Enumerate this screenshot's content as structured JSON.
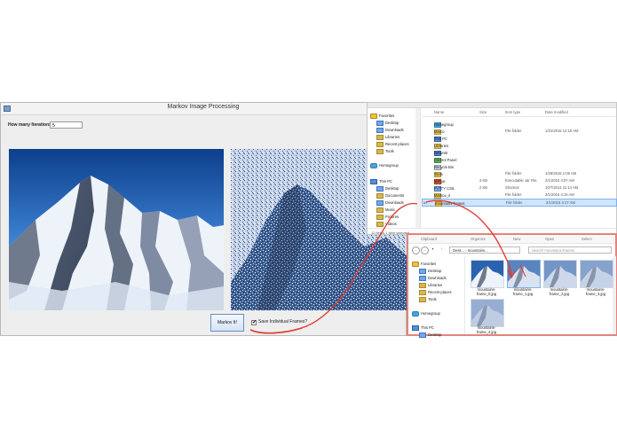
{
  "main_window": {
    "title": "Markov Image Processing",
    "iterations_label": "How many Iterations:",
    "iterations_value": "5",
    "markov_button": "Markov It!",
    "save_frames_label": "Save Individual Frames?",
    "save_frames_checked": "✔"
  },
  "explorer1": {
    "nav": {
      "favorites": "Favorites",
      "desktop": "Desktop",
      "downloads": "Downloads",
      "libraries": "Libraries",
      "recent": "Recent places",
      "tools": "Tools",
      "homegroup": "Homegroup",
      "this_pc": "This PC",
      "pc_items": [
        "Desktop",
        "Documents",
        "Downloads",
        "Music",
        "Pictures",
        "Videos"
      ]
    },
    "columns": [
      "Name",
      "Size",
      "Item type",
      "Date modified"
    ],
    "files": [
      {
        "name": "Homegroup",
        "size": "",
        "type": "",
        "date": ""
      },
      {
        "name": "Marco",
        "size": "",
        "type": "File folder",
        "date": "1/31/2015 12:19 AM"
      },
      {
        "name": "This PC",
        "size": "",
        "type": "",
        "date": ""
      },
      {
        "name": "Libraries",
        "size": "",
        "type": "",
        "date": ""
      },
      {
        "name": "Network",
        "size": "",
        "type": "",
        "date": ""
      },
      {
        "name": "Control Panel",
        "size": "",
        "type": "",
        "date": ""
      },
      {
        "name": "Recycle Bin",
        "size": "",
        "type": "",
        "date": ""
      },
      {
        "name": "Tools",
        "size": "",
        "type": "File folder",
        "date": "1/28/2015 1:06 AM"
      },
      {
        "name": "MIP.jar",
        "size": "3 KB",
        "type": "Executable Jar File",
        "date": "2/1/2015 4:07 AM"
      },
      {
        "name": "PuTTY CSIL",
        "size": "2 KB",
        "type": "Shortcut",
        "date": "10/7/2014 11:14 AM"
      },
      {
        "name": "Markov_it",
        "size": "",
        "type": "File folder",
        "date": "2/1/2015 4:15 AM"
      },
      {
        "name": "mountains-frames",
        "size": "",
        "type": "File folder",
        "date": "2/1/2015 4:17 AM"
      }
    ],
    "status": "12 items    1 item selected"
  },
  "explorer2": {
    "ribbon": [
      "Clipboard",
      "Organize",
      "New",
      "Open",
      "Select"
    ],
    "address": "Desk... › mountains...",
    "search_placeholder": "Search mountains-frames",
    "nav": {
      "favorites": "Favorites",
      "desktop": "Desktop",
      "downloads": "Downloads",
      "libraries": "Libraries",
      "recent": "Recent places",
      "tools": "Tools",
      "homegroup": "Homegroup",
      "this_pc": "This PC",
      "desktop2": "Desktop"
    },
    "thumbnails": [
      "mountains-frame_0.jpg",
      "mountains-frame_1.jpg",
      "mountains-frame_2.jpg",
      "mountains-frame_3.jpg",
      "mountains-frame_4.jpg"
    ]
  },
  "colors": {
    "annotation_red": "#e03a30",
    "selection_blue": "#cfe5fb",
    "sky_blue": "#1c5fb0",
    "snow": "#f4f7fb"
  }
}
